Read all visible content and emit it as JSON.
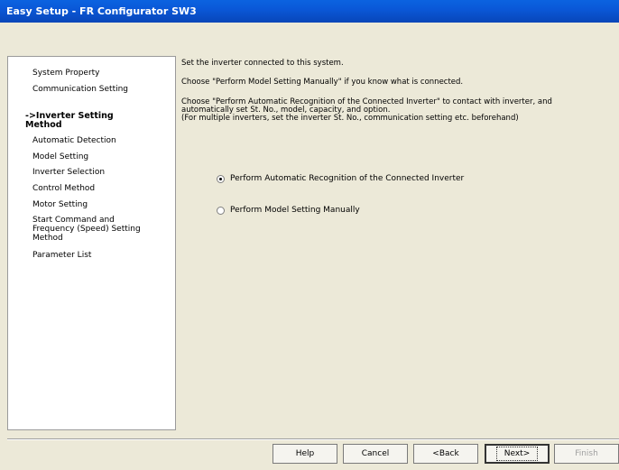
{
  "window": {
    "title": "Easy Setup - FR Configurator SW3"
  },
  "nav": {
    "items": [
      {
        "label": "System Property"
      },
      {
        "label": "Communication Setting"
      },
      {
        "label": "->Inverter Setting\nMethod",
        "current": true
      },
      {
        "label": "Automatic Detection"
      },
      {
        "label": "Model Setting"
      },
      {
        "label": "Inverter Selection"
      },
      {
        "label": "Control Method"
      },
      {
        "label": "Motor Setting"
      },
      {
        "label": "Start Command and\nFrequency (Speed) Setting\nMethod"
      },
      {
        "label": "Parameter List"
      }
    ]
  },
  "main": {
    "line1": "Set the inverter connected to this system.",
    "line2": "Choose \"Perform Model Setting Manually\" if you know what is connected.",
    "line3": "Choose \"Perform Automatic Recognition of the Connected Inverter\" to contact with inverter, and\nautomatically set St. No., model, capacity, and option.\n(For multiple inverters, set the inverter St. No., communication setting etc. beforehand)",
    "options": [
      {
        "label": "Perform Automatic Recognition of the Connected Inverter",
        "selected": true
      },
      {
        "label": "Perform Model Setting Manually",
        "selected": false
      }
    ]
  },
  "buttons": {
    "help": "Help",
    "cancel": "Cancel",
    "back": "<Back",
    "next": "Next>",
    "finish": "Finish"
  }
}
